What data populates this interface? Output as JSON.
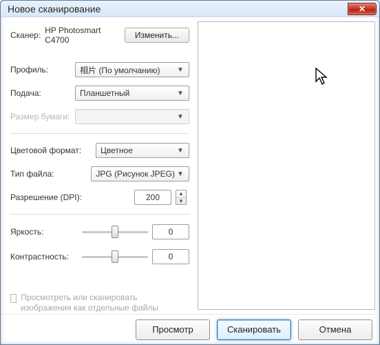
{
  "window": {
    "title": "Новое сканирование"
  },
  "scanner": {
    "label": "Сканер:",
    "value": "HP Photosmart C4700",
    "change_btn": "Изменить..."
  },
  "profile": {
    "label": "Профиль:",
    "value": "相片 (По умолчанию)"
  },
  "source": {
    "label": "Подача:",
    "value": "Планшетный"
  },
  "paper": {
    "label": "Размер бумаги:",
    "value": ""
  },
  "color": {
    "label": "Цветовой формат:",
    "value": "Цветное"
  },
  "filetype": {
    "label": "Тип файла:",
    "value": "JPG (Рисунок JPEG)"
  },
  "dpi": {
    "label": "Разрешение (DPI):",
    "value": "200"
  },
  "brightness": {
    "label": "Яркость:",
    "value": "0"
  },
  "contrast": {
    "label": "Контрастность:",
    "value": "0"
  },
  "separate": {
    "label": "Просмотреть или сканировать изображения как отдельные файлы"
  },
  "buttons": {
    "preview": "Просмотр",
    "scan": "Сканировать",
    "cancel": "Отмена"
  }
}
